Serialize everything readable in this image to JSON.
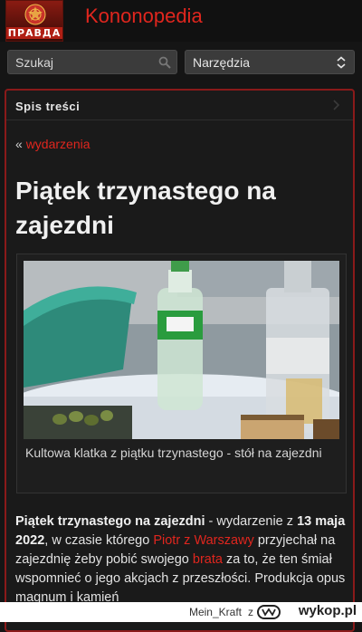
{
  "header": {
    "logo_text": "ПРАВДА",
    "site_title": "Kononopedia",
    "top_partial": ""
  },
  "search": {
    "placeholder": "Szukaj",
    "icon": "search-icon"
  },
  "tools": {
    "label": "Narzędzia",
    "icon": "chevron-updown-icon"
  },
  "toc": {
    "label": "Spis treści"
  },
  "breadcrumb": {
    "prefix": "«",
    "link": "wydarzenia"
  },
  "page": {
    "title": "Piątek trzynastego na zajezdni"
  },
  "figure": {
    "caption": "Kultowa klatka z piątku trzynastego - stół na zajezdni"
  },
  "article": {
    "bold_title": "Piątek trzynastego na zajezdni",
    "t1": " - wydarzenie z ",
    "bold_date": "13 maja 2022",
    "t2": ", w czasie którego ",
    "link1": "Piotr z Warszawy",
    "t3": " przyjechał na zajezdnię żeby pobić swojego ",
    "link2": "brata",
    "t4": " za to, że ten śmiał wspomnieć o jego akcjach z przeszłości. Produkcja opus magnum i kamień"
  },
  "watermark": {
    "user": "Mein_Kraft",
    "z": "z",
    "site": "wykop.pl"
  },
  "colors": {
    "background": "#151515",
    "accent_red": "#e0261e",
    "panel_border": "#8a1a1a",
    "control_bg": "#3b3b3b"
  }
}
